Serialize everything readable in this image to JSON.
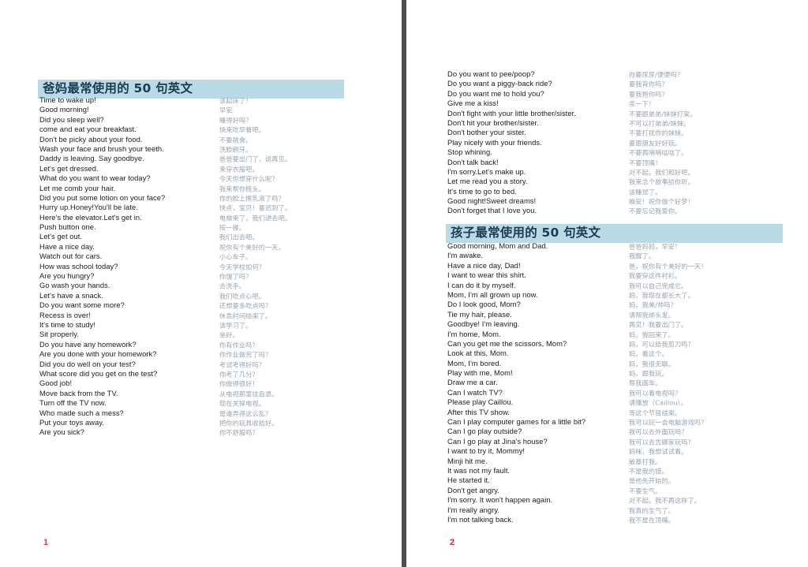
{
  "document": {
    "colors": {
      "heading_background": "#b9dbe6",
      "heading_text": "#1b3a54",
      "english_text": "#1c1c1c",
      "chinese_text": "#9aa3ae",
      "folio": "#d0203a",
      "page_background": "#ffffff",
      "gutter": "#4a4a4a"
    }
  },
  "pages": [
    {
      "folio": "1",
      "sections": [
        {
          "heading": "爸妈最常使用的 50 句英文",
          "rows": [
            {
              "en": "Time to wake up!",
              "zh": "该起床了！"
            },
            {
              "en": "Good morning!",
              "zh": "早安"
            },
            {
              "en": "Did you sleep well?",
              "zh": "睡得好吗？"
            },
            {
              "en": "come and eat your breakfast.",
              "zh": "快来吃早餐吧。"
            },
            {
              "en": "Don't be picky about your food.",
              "zh": "不要挑食。"
            },
            {
              "en": "Wash your face and brush your teeth.",
              "zh": "洗脸刷牙。"
            },
            {
              "en": "Daddy is leaving. Say goodbye.",
              "zh": "爸爸要出门了，说再见。"
            },
            {
              "en": "Let's get dressed.",
              "zh": "来穿衣服吧。"
            },
            {
              "en": "What do you want to wear today?",
              "zh": "今天你想穿什么呢？"
            },
            {
              "en": "Let me comb your hair.",
              "zh": "我来帮你梳头。"
            },
            {
              "en": "Did you put some lotion on your face?",
              "zh": "你的脸上擦乳液了吗？"
            },
            {
              "en": "Hurry up.Honey!You'll be late.",
              "zh": "快点，宝贝！要迟到了。"
            },
            {
              "en": "Here's the elevator.Let's get in.",
              "zh": "电梯来了，我们进去吧。"
            },
            {
              "en": "Push button one.",
              "zh": "按一楼。"
            },
            {
              "en": "Let's get out.",
              "zh": "我们出去吧。"
            },
            {
              "en": "Have a nice day.",
              "zh": "祝你有个美好的一天。"
            },
            {
              "en": "Watch out for cars.",
              "zh": "小心车子。"
            },
            {
              "en": "How was school today?",
              "zh": "今天学校如何？"
            },
            {
              "en": "Are you hungry?",
              "zh": "你饿了吗？"
            },
            {
              "en": "Go wash your hands.",
              "zh": "去洗手。"
            },
            {
              "en": "Let's have a snack.",
              "zh": "我们吃点心吧。"
            },
            {
              "en": "Do you want some more?",
              "zh": "还想要多吃点吗？"
            },
            {
              "en": "Recess is over!",
              "zh": "休息时间结束了。"
            },
            {
              "en": "It's time to study!",
              "zh": "该学习了。"
            },
            {
              "en": "Sit properly.",
              "zh": "坐好。"
            },
            {
              "en": "Do you have any homework?",
              "zh": "你有作业吗？"
            },
            {
              "en": "Are you done with your homework?",
              "zh": "你作业做完了吗？"
            },
            {
              "en": "Did you do well on your test?",
              "zh": "考试考得好吗？"
            },
            {
              "en": "What score did you get on the test?",
              "zh": "你考了几分？"
            },
            {
              "en": "Good job!",
              "zh": "你做得很好！"
            },
            {
              "en": "Move back from the TV.",
              "zh": "从电视那里往后退。"
            },
            {
              "en": "Turn off the TV now.",
              "zh": "现在关掉电视。"
            },
            {
              "en": "Who made such a mess?",
              "zh": "是谁弄得这么乱？"
            },
            {
              "en": "Put your toys away.",
              "zh": "把你的玩具收拾好。"
            },
            {
              "en": "Are you sick?",
              "zh": "你不舒服吗？"
            }
          ]
        }
      ]
    },
    {
      "folio": "2",
      "sections": [
        {
          "heading": "",
          "rows": [
            {
              "en": "Do you want to pee/poop?",
              "zh": "你要尿尿/便便吗？"
            },
            {
              "en": "Do you want a piggy-back ride?",
              "zh": "要我背你吗？"
            },
            {
              "en": "Do you want me to hold you?",
              "zh": "要我抱你吗？"
            },
            {
              "en": "Give me a kiss!",
              "zh": "亲一下！"
            },
            {
              "en": "Don't fight with your little brother/sister.",
              "zh": "不要跟弟弟/妹妹打架。"
            },
            {
              "en": "Don't hit your brother/sister.",
              "zh": "不可以打弟弟/妹妹。"
            },
            {
              "en": "Don't bother your sister.",
              "zh": "不要打扰你的妹妹。"
            },
            {
              "en": "Play nicely with your friends.",
              "zh": "要跟朋友好好玩。"
            },
            {
              "en": "Stop whining.",
              "zh": "不要再嘀嘀咕咕了。"
            },
            {
              "en": "Don't talk back!",
              "zh": "不要顶嘴！"
            },
            {
              "en": "I'm sorry.Let's make up.",
              "zh": "对不起，我们和好吧。"
            },
            {
              "en": "Let me read you a story.",
              "zh": "我来念个故事给你听。"
            },
            {
              "en": "It's time to go to bed.",
              "zh": "该睡觉了。"
            },
            {
              "en": "Good night!Sweet dreams!",
              "zh": "晚安！祝你做个好梦！"
            },
            {
              "en": "Don't forget that I love you.",
              "zh": "不要忘记我爱你。"
            }
          ]
        },
        {
          "heading": "孩子最常使用的 50 句英文",
          "rows": [
            {
              "en": "Good morning, Mom and Dad.",
              "zh": "爸爸妈妈，早安！"
            },
            {
              "en": "I'm awake.",
              "zh": "我醒了。"
            },
            {
              "en": "Have a nice day, Dad!",
              "zh": "爸，祝你有个美好的一天！"
            },
            {
              "en": "I want to wear this shirt.",
              "zh": "我要穿这件衬衫。"
            },
            {
              "en": "I can do it by myself.",
              "zh": "我可以自己完成它。"
            },
            {
              "en": "Mom, I'm all grown up now.",
              "zh": "妈，我现在都长大了。"
            },
            {
              "en": "Do I look good, Mom?",
              "zh": "妈，我美/帅吗？"
            },
            {
              "en": "Tie my hair, please.",
              "zh": "请帮我绑头发。"
            },
            {
              "en": "Goodbye! I'm leaving.",
              "zh": "再见！我要出门了。"
            },
            {
              "en": "I'm home, Mom.",
              "zh": "妈，我回来了。"
            },
            {
              "en": "Can you get me the scissors, Mom?",
              "zh": "妈，可以给我剪刀吗？"
            },
            {
              "en": "Look at this, Mom.",
              "zh": "妈，看这个。"
            },
            {
              "en": "Mom, I'm bored.",
              "zh": "妈，我很无聊。"
            },
            {
              "en": "Play with me, Mom!",
              "zh": "妈，跟我玩。"
            },
            {
              "en": "Draw me a car.",
              "zh": "帮我画车。"
            },
            {
              "en": "Can I watch TV?",
              "zh": "我可以看电视吗？"
            },
            {
              "en": "Please play Caillou.",
              "zh": "请播放（Caillou）。"
            },
            {
              "en": "After this TV show.",
              "zh": "等这个节目结束。"
            },
            {
              "en": "Can I play computer games for a little bit?",
              "zh": "我可以玩一会电脑游戏吗？"
            },
            {
              "en": "Can I go play outside?",
              "zh": "我可以去外面玩吗？"
            },
            {
              "en": "Can I go play at Jina's house?",
              "zh": "我可以去吉娜家玩吗？"
            },
            {
              "en": "I want to try it, Mommy!",
              "zh": "妈咪，我想试试看。"
            },
            {
              "en": "Minji hit me.",
              "zh": "敏基打我。"
            },
            {
              "en": "It was not my fault.",
              "zh": "不是我的错。"
            },
            {
              "en": "He started it.",
              "zh": "是他先开始的。"
            },
            {
              "en": "Don't get angry.",
              "zh": "不要生气。"
            },
            {
              "en": "I'm sorry. It won't happen again.",
              "zh": "对不起，我不再这样了。"
            },
            {
              "en": "I'm really angry.",
              "zh": "我真的生气了。"
            },
            {
              "en": "I'm not talking back.",
              "zh": "我不是在顶嘴。"
            }
          ]
        }
      ]
    }
  ]
}
